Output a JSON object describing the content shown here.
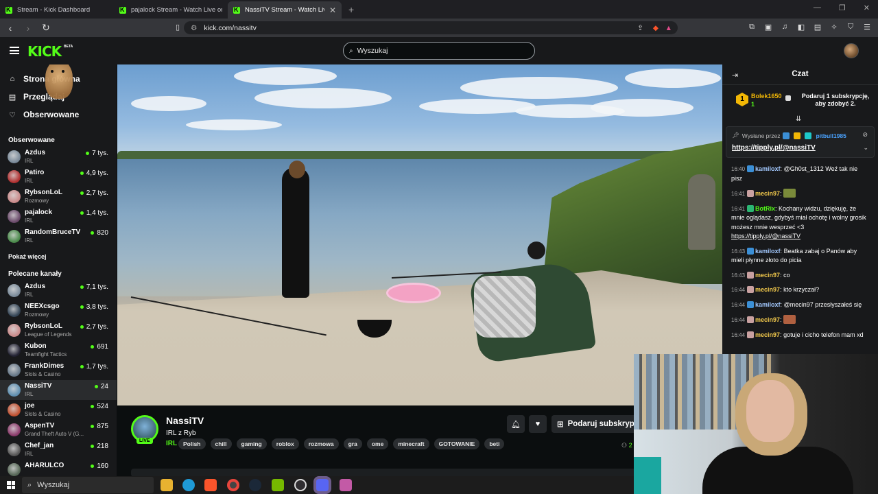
{
  "browser": {
    "tabs": [
      {
        "title": "Stream - Kick Dashboard"
      },
      {
        "title": "pajalock Stream - Watch Live on Kick"
      },
      {
        "title": "NassiTV Stream - Watch Live on Kick"
      }
    ],
    "url": "kick.com/nassitv"
  },
  "header": {
    "logo": "KICK",
    "beta": "BETA",
    "search_placeholder": "Wyszukaj"
  },
  "sidebar": {
    "nav": [
      {
        "label": "Strona główna",
        "icon": "home-icon"
      },
      {
        "label": "Przeglądaj",
        "icon": "browse-icon"
      },
      {
        "label": "Obserwowane",
        "icon": "heart-icon"
      }
    ],
    "followed_heading": "Obserwowane",
    "followed": [
      {
        "name": "Azdus",
        "category": "IRL",
        "viewers": "7 tys.",
        "color": "#7a8a99"
      },
      {
        "name": "Patiro",
        "category": "IRL",
        "viewers": "4,9 tys.",
        "color": "#b03030"
      },
      {
        "name": "RybsonLoL",
        "category": "Rozmowy",
        "viewers": "2,7 tys.",
        "color": "#c98a8a"
      },
      {
        "name": "pajalock",
        "category": "IRL",
        "viewers": "1,4 tys.",
        "color": "#6a4a6a"
      },
      {
        "name": "RandomBruceTV",
        "category": "IRL",
        "viewers": "820",
        "color": "#4a8a4a"
      }
    ],
    "show_more": "Pokaż więcej",
    "recommended_heading": "Polecane kanały",
    "recommended": [
      {
        "name": "Azdus",
        "category": "IRL",
        "viewers": "7,1 tys.",
        "color": "#7a8a99"
      },
      {
        "name": "NEEXcsgo",
        "category": "Rozmowy",
        "viewers": "3,8 tys.",
        "color": "#334455"
      },
      {
        "name": "RybsonLoL",
        "category": "League of Legends",
        "viewers": "2,7 tys.",
        "color": "#c98a8a"
      },
      {
        "name": "Kubon",
        "category": "Teamfight Tactics",
        "viewers": "691",
        "color": "#222233"
      },
      {
        "name": "FrankDimes",
        "category": "Slots & Casino",
        "viewers": "1,7 tys.",
        "color": "#667788"
      },
      {
        "name": "NassiTV",
        "category": "IRL",
        "viewers": "24",
        "color": "#5f8fb0",
        "selected": true
      },
      {
        "name": "joe",
        "category": "Slots & Casino",
        "viewers": "524",
        "color": "#c05030"
      },
      {
        "name": "AspenTV",
        "category": "Grand Theft Auto V (G...",
        "viewers": "875",
        "color": "#8a3a6a"
      },
      {
        "name": "Chef_jan",
        "category": "IRL",
        "viewers": "218",
        "color": "#555555"
      },
      {
        "name": "AHARULCO",
        "category": "",
        "viewers": "160",
        "color": "#556655"
      }
    ]
  },
  "stream": {
    "name": "NassiTV",
    "live_badge": "LIVE",
    "title": "IRL z Ryb",
    "category": "IRL",
    "tags": [
      "Polish",
      "chill",
      "gaming",
      "roblox",
      "rozmowa",
      "gra",
      "ome",
      "minecraft",
      "GOTOWANIE",
      "beti"
    ],
    "subscribe_label": "Podaruj subskrypcję",
    "followers_fragment": "2"
  },
  "chat": {
    "title": "Czat",
    "gift": {
      "rank": "1",
      "user": "Bolek1650",
      "count": "1",
      "text": "Podaruj 1 subskrypcję, aby zdobyć 2."
    },
    "pinned": {
      "sent_by": "Wysłane przez",
      "user": "pitbull1985",
      "link": "https://tipply.pl/@nassiTV"
    },
    "messages": [
      {
        "time": "16:40",
        "user": "kamiloxf",
        "user_color": "#a3c9ff",
        "badge_color": "#3b8fd6",
        "text": "@Gh0st_1312 Weź tak nie pisz"
      },
      {
        "time": "16:41",
        "user": "mecin97",
        "user_color": "#f2c94c",
        "badge_color": "#c9a1a1",
        "text": "",
        "emote_color": "#7a8a3a"
      },
      {
        "time": "16:41",
        "user": "BotRix",
        "user_color": "#53fc18",
        "badge_color": "#2bb673",
        "text": "Kochany widzu, dziękuję, że mnie oglądasz, gdybyś miał ochotę i wolny grosik możesz mnie wesprzeć <3",
        "link": "https://tipply.pl/@nassiTV"
      },
      {
        "time": "16:43",
        "user": "kamiloxf",
        "user_color": "#a3c9ff",
        "badge_color": "#3b8fd6",
        "text": "Beatka zabaj o Panów aby mieli płynne złoto do picia"
      },
      {
        "time": "16:43",
        "user": "mecin97",
        "user_color": "#f2c94c",
        "badge_color": "#c9a1a1",
        "text": "co"
      },
      {
        "time": "16:44",
        "user": "mecin97",
        "user_color": "#f2c94c",
        "badge_color": "#c9a1a1",
        "text": "kto krzyczał?"
      },
      {
        "time": "16:44",
        "user": "kamiloxf",
        "user_color": "#a3c9ff",
        "badge_color": "#3b8fd6",
        "text": "@mecin97 przesłyszałeś się"
      },
      {
        "time": "16:44",
        "user": "mecin97",
        "user_color": "#f2c94c",
        "badge_color": "#c9a1a1",
        "text": "",
        "emote_color": "#b06040"
      },
      {
        "time": "16:44",
        "user": "mecin97",
        "user_color": "#f2c94c",
        "badge_color": "#c9a1a1",
        "text": "gotuje i cicho telefon mam xd"
      }
    ]
  },
  "taskbar": {
    "search_placeholder": "Wyszukaj"
  }
}
